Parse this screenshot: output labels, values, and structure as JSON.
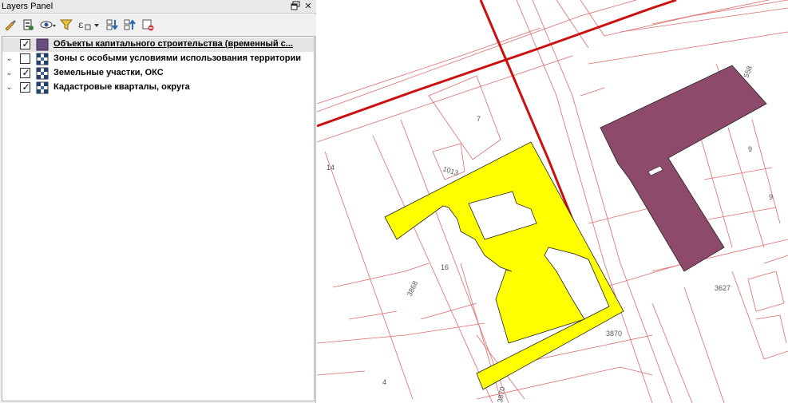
{
  "panel": {
    "title": "Layers Panel",
    "float_icon": "float-window-icon",
    "close_icon": "close-icon",
    "toolbar": [
      {
        "name": "style-manager-icon"
      },
      {
        "name": "add-group-icon"
      },
      {
        "name": "visibility-eye-icon"
      },
      {
        "name": "filter-legend-icon"
      },
      {
        "name": "filter-expression-icon"
      },
      {
        "name": "expand-all-icon"
      },
      {
        "name": "collapse-all-icon"
      },
      {
        "name": "remove-layer-icon"
      }
    ],
    "layers": [
      {
        "label": "Объекты капитального строительства (временный с...",
        "checked": true,
        "expanded": false,
        "icon": "polygon-fill-icon",
        "color": "#6a4c7e",
        "selected": true
      },
      {
        "label": "Зоны с особыми условиями использования территории",
        "checked": false,
        "expanded": true,
        "icon": "rule-style-icon",
        "selected": false
      },
      {
        "label": "Земельные участки, ОКС",
        "checked": true,
        "expanded": true,
        "icon": "rule-style-icon",
        "selected": false
      },
      {
        "label": "Кадастровые кварталы, округа",
        "checked": true,
        "expanded": true,
        "icon": "rule-style-icon",
        "selected": false
      }
    ]
  },
  "map": {
    "colors": {
      "boundary": "#e06060",
      "road": "#cc0000",
      "yellow_parcel": "#ffff00",
      "building": "#8e4a6a"
    },
    "labels": [
      "7",
      "1013",
      "14",
      "16",
      "3868",
      "3870",
      "3627",
      "9",
      "9",
      "558",
      "4",
      "3870"
    ]
  }
}
